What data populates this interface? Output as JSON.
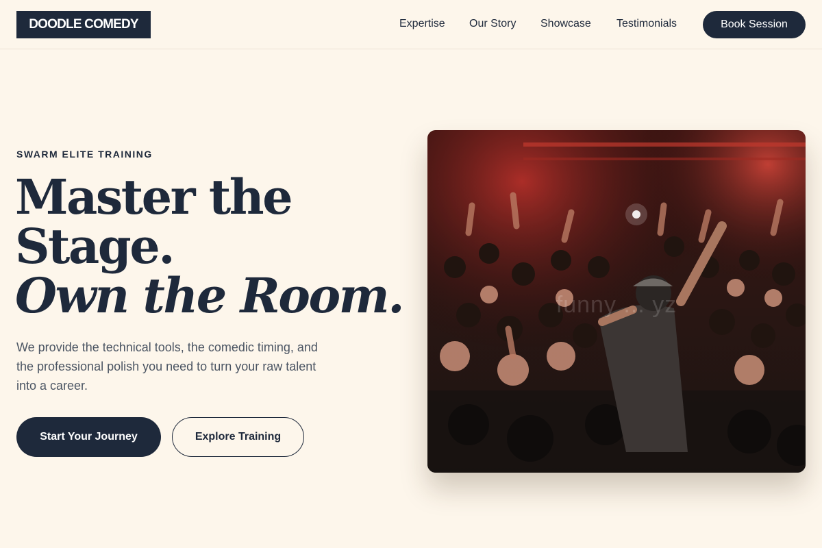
{
  "header": {
    "logo": "DOODLE COMEDY",
    "nav": [
      "Expertise",
      "Our Story",
      "Showcase",
      "Testimonials"
    ],
    "cta": "Book Session"
  },
  "hero": {
    "eyebrow": "SWARM ELITE TRAINING",
    "headline_line1": "Master the",
    "headline_line2": "Stage.",
    "headline_line3": "Own the Room.",
    "lede": "We provide the technical tools, the comedic timing, and the professional polish you need to turn your raw talent into a career.",
    "primary_button": "Start Your Journey",
    "secondary_button": "Explore Training",
    "image_watermark": "funny ... yz"
  },
  "colors": {
    "background": "#fdf6eb",
    "navy": "#1e293b",
    "body_text": "#4b5563"
  }
}
